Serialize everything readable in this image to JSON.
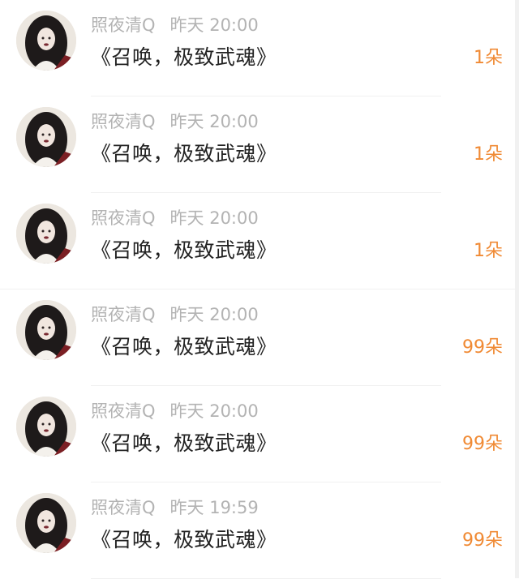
{
  "records": [
    {
      "user": "照夜清Q",
      "time": "昨天 20:00",
      "title": "《召唤，极致武魂》",
      "gift": "1朵"
    },
    {
      "user": "照夜清Q",
      "time": "昨天 20:00",
      "title": "《召唤，极致武魂》",
      "gift": "1朵"
    },
    {
      "user": "照夜清Q",
      "time": "昨天 20:00",
      "title": "《召唤，极致武魂》",
      "gift": "1朵"
    },
    {
      "user": "照夜清Q",
      "time": "昨天 20:00",
      "title": "《召唤，极致武魂》",
      "gift": "99朵"
    },
    {
      "user": "照夜清Q",
      "time": "昨天 20:00",
      "title": "《召唤，极致武魂》",
      "gift": "99朵"
    },
    {
      "user": "照夜清Q",
      "time": "昨天 19:59",
      "title": "《召唤，极致武魂》",
      "gift": "99朵"
    }
  ],
  "colors": {
    "gift": "#f08a34",
    "meta": "#b3b3b3",
    "title": "#222222"
  },
  "icons": {
    "avatar": "avatar-portrait-icon"
  }
}
